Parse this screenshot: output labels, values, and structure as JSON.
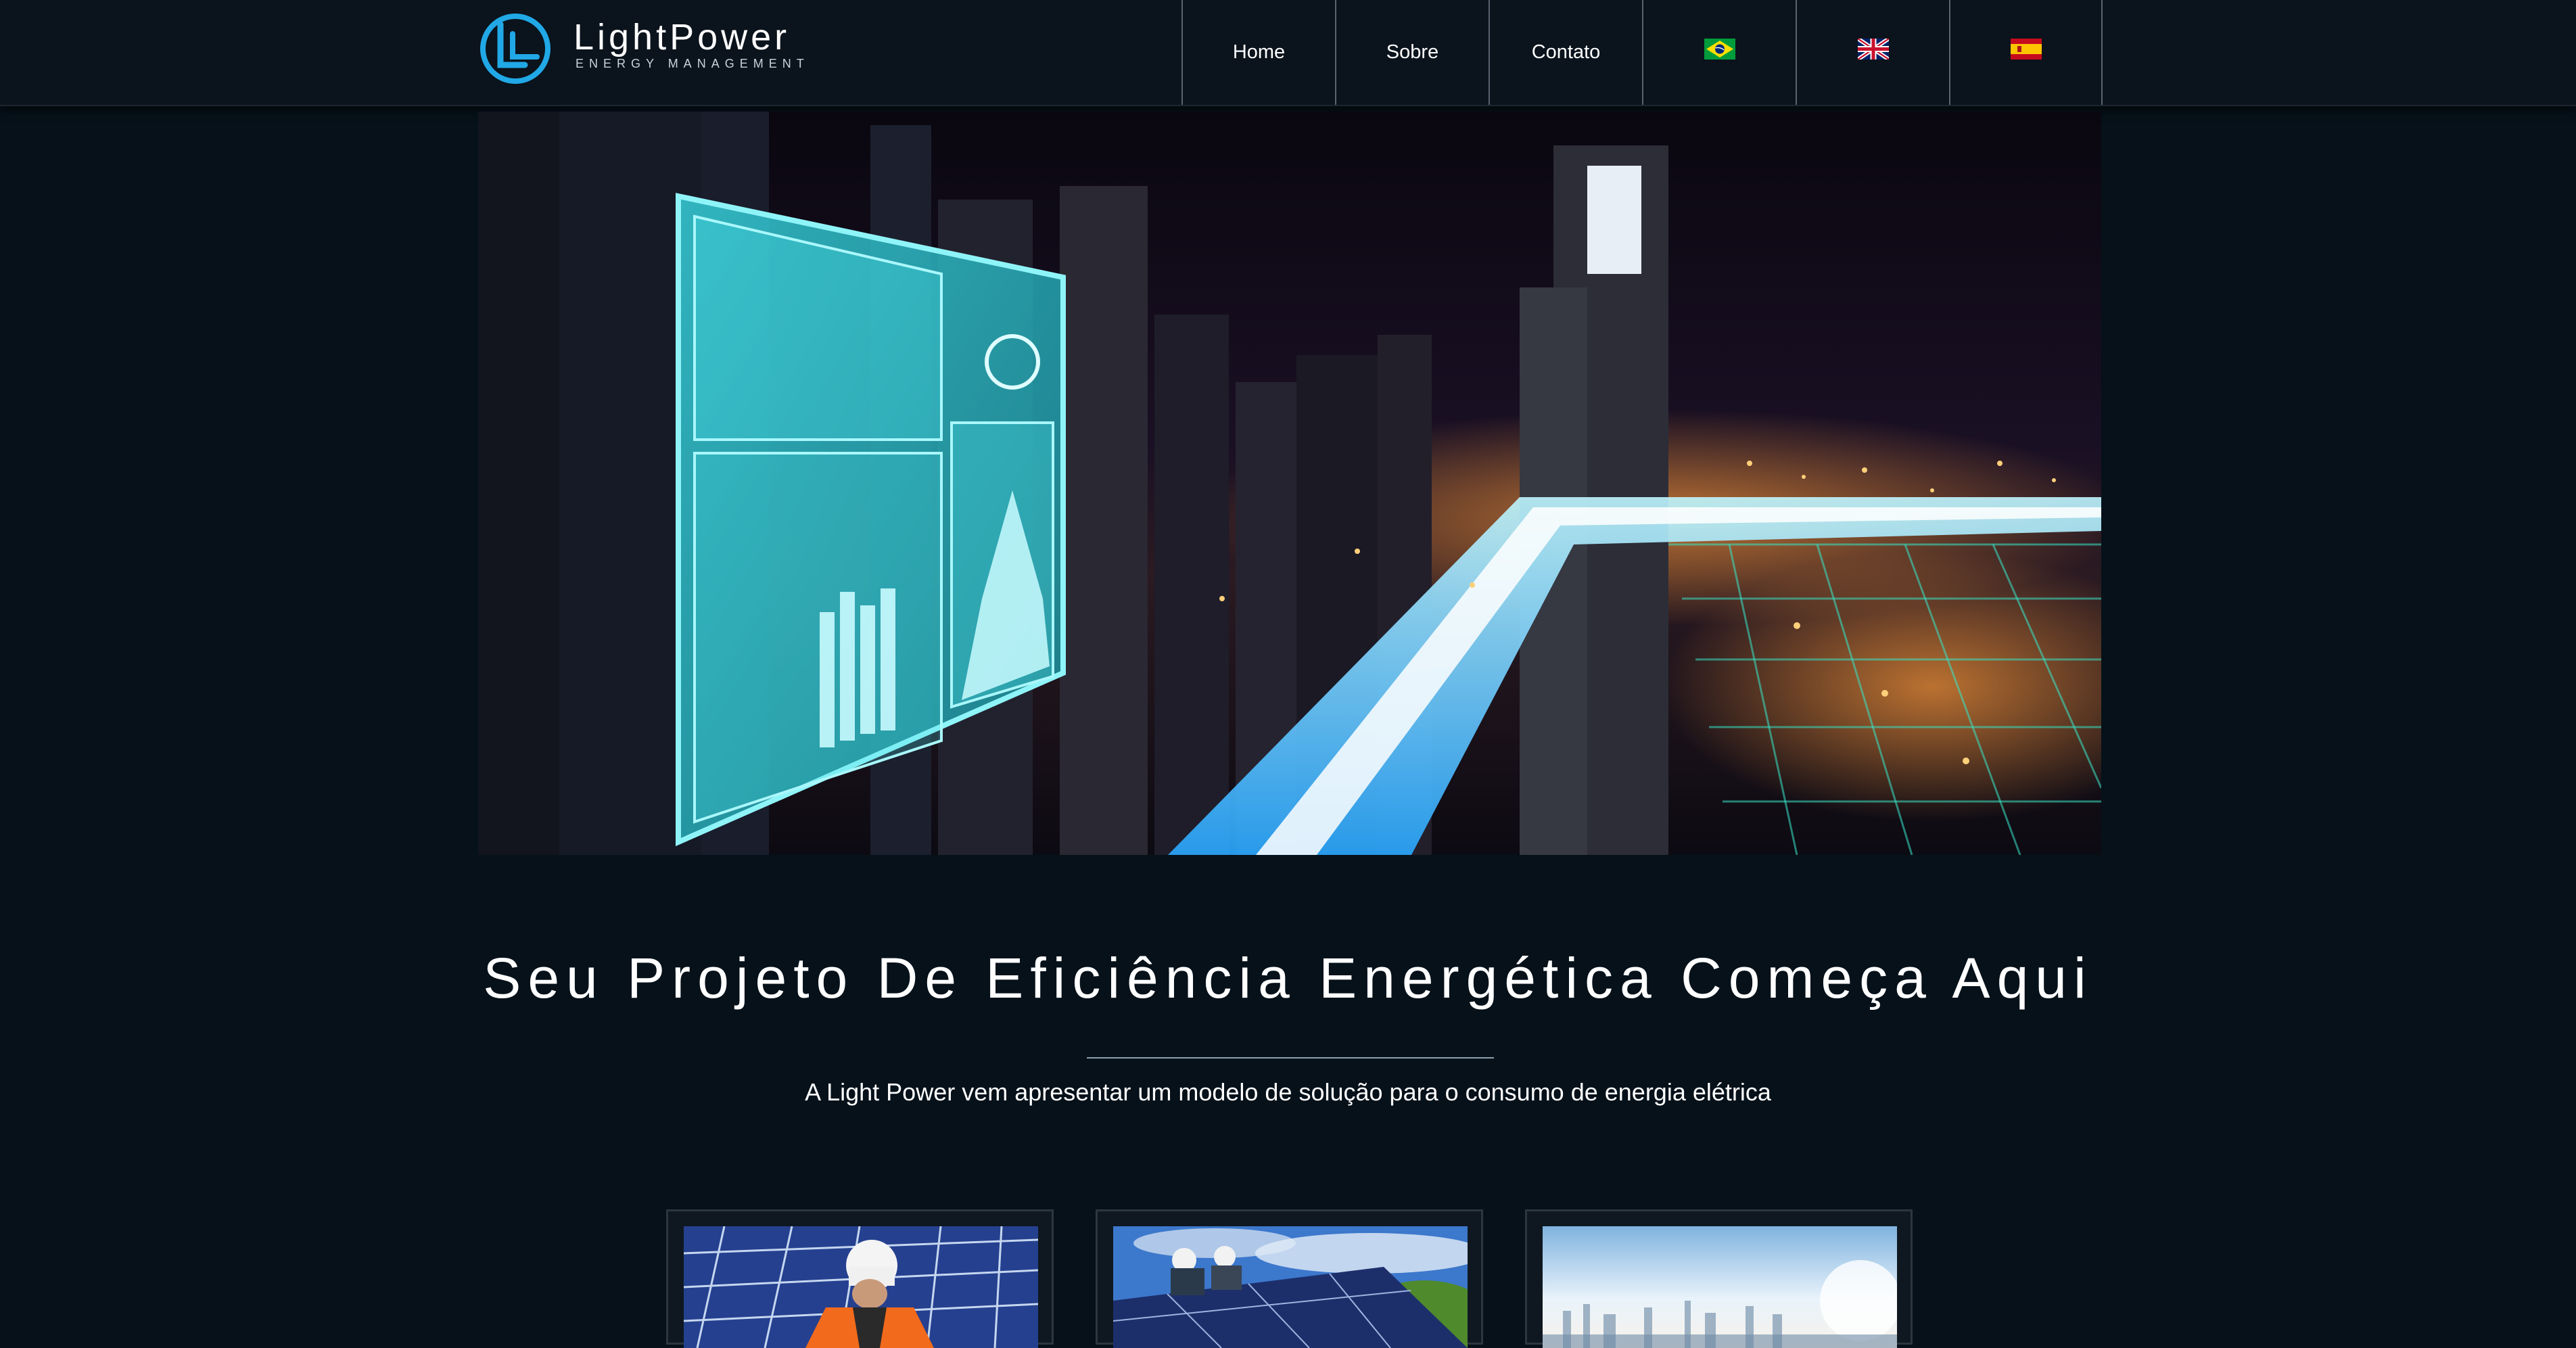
{
  "brand": {
    "name": "LightPower",
    "tagline": "ENERGY MANAGEMENT",
    "accent_color": "#21a8e6"
  },
  "nav": {
    "items": [
      {
        "label": "Home"
      },
      {
        "label": "Sobre"
      },
      {
        "label": "Contato"
      }
    ],
    "languages": [
      {
        "icon": "flag-brazil-icon"
      },
      {
        "icon": "flag-uk-icon"
      },
      {
        "icon": "flag-spain-icon"
      }
    ]
  },
  "hero": {
    "image": "night-city-energy-dashboard-photo"
  },
  "intro": {
    "headline": "Seu Projeto De Eficiência Energética Começa Aqui",
    "subtitle": "A Light Power vem apresentar um modelo de solução para o consumo de energia elétrica"
  },
  "cards": [
    {
      "image": "technician-solar-panels-photo"
    },
    {
      "image": "workers-installing-rooftop-solar-photo"
    },
    {
      "image": "city-skyline-photo"
    }
  ]
}
